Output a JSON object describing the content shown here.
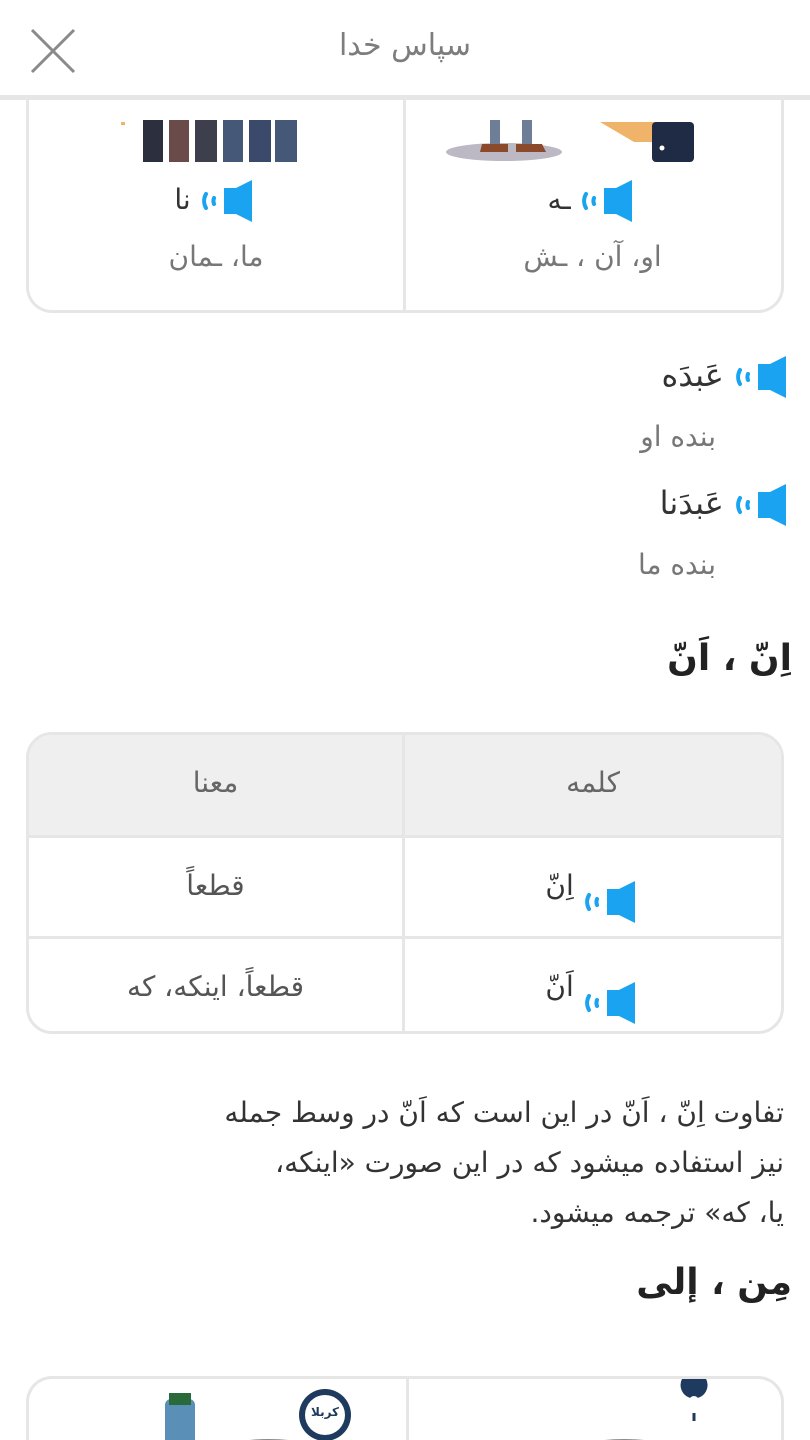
{
  "header": {
    "title": "سپاس خدا"
  },
  "pronoun_card": {
    "right": {
      "pronoun": "ـه",
      "meaning": "او، آن ، ـش"
    },
    "left": {
      "pronoun": "نا",
      "meaning": "ما، ـمان"
    }
  },
  "examples": [
    {
      "word": "عَبدَه",
      "meaning": "بنده او"
    },
    {
      "word": "عَبدَنا",
      "meaning": "بنده ما"
    }
  ],
  "section1": {
    "heading": "اِنّ ، اَنّ"
  },
  "table": {
    "header": {
      "word": "کلمه",
      "meaning": "معنا"
    },
    "rows": [
      {
        "word": "اِنّ",
        "meaning": "قطعاً"
      },
      {
        "word": "اَنّ",
        "meaning": "قطعاً، اینکه، که"
      }
    ]
  },
  "paragraph": {
    "lines": [
      "تفاوت اِنّ ، اَنّ در این است که اَنّ در وسط جمله",
      "نیز استفاده میشود که در این صورت «اینکه،",
      "یا، که» ترجمه میشود."
    ]
  },
  "section2": {
    "heading": "مِن ، إلی",
    "pin_label": "کربلا"
  },
  "colors": {
    "accent": "#1aa3f0",
    "border": "#e6e6e6",
    "header_bg": "#efefef"
  }
}
